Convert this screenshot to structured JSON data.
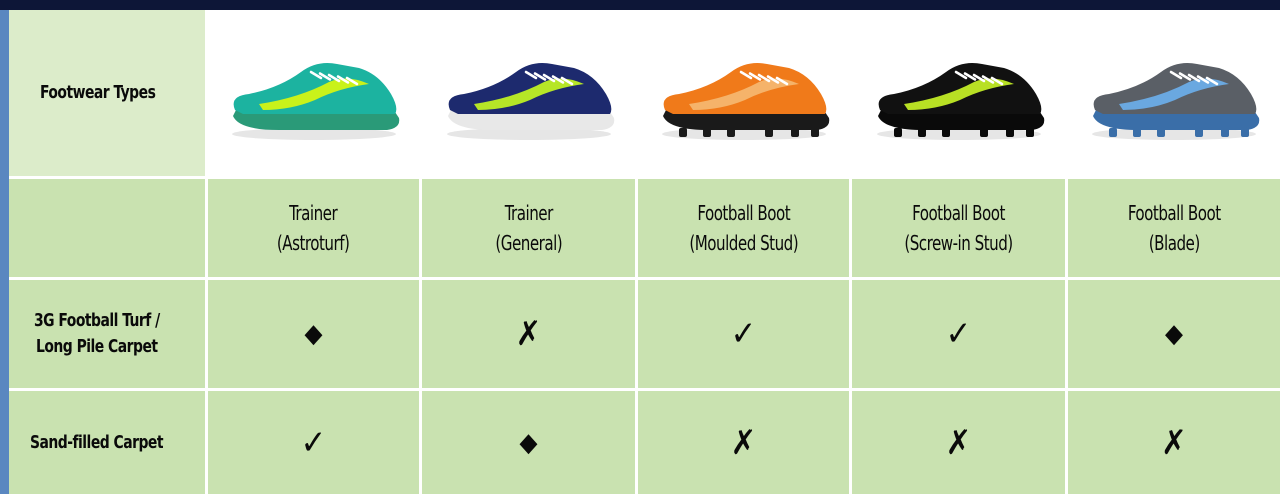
{
  "table": {
    "header_label": "Footwear Types",
    "shoes": [
      {
        "name": "Trainer",
        "subtype": "(Astroturf)",
        "upper_color": "#1cb3a0",
        "accent_color": "#c9f21a",
        "sole_color": "#2a9a78"
      },
      {
        "name": "Trainer",
        "subtype": "(General)",
        "upper_color": "#1d2a6e",
        "accent_color": "#b6e627",
        "sole_color": "#e8e8e8"
      },
      {
        "name": "Football Boot",
        "subtype": "(Moulded Stud)",
        "upper_color": "#f07a1a",
        "accent_color": "#f5b36a",
        "sole_color": "#1a1a1a"
      },
      {
        "name": "Football Boot",
        "subtype": "(Screw-in Stud)",
        "upper_color": "#111111",
        "accent_color": "#b8e024",
        "sole_color": "#0a0a0a"
      },
      {
        "name": "Football Boot",
        "subtype": "(Blade)",
        "upper_color": "#5a5f66",
        "accent_color": "#6aa8e0",
        "sole_color": "#3a6ea8"
      }
    ],
    "rows": [
      {
        "label_line1": "3G Football Turf /",
        "label_line2": "Long Pile Carpet",
        "marks": [
          "diamond",
          "cross",
          "check",
          "check",
          "diamond"
        ]
      },
      {
        "label_line1": "Sand-filled Carpet",
        "label_line2": "",
        "marks": [
          "check",
          "diamond",
          "cross",
          "cross",
          "cross"
        ]
      }
    ],
    "symbols": {
      "check": "✓",
      "cross": "✗",
      "diamond": "◆"
    },
    "colors": {
      "cell_background": "#c9e2b0",
      "header_label_background": "#dcecca",
      "top_bar": "#0d1637",
      "frame": "#4a79b4"
    }
  }
}
